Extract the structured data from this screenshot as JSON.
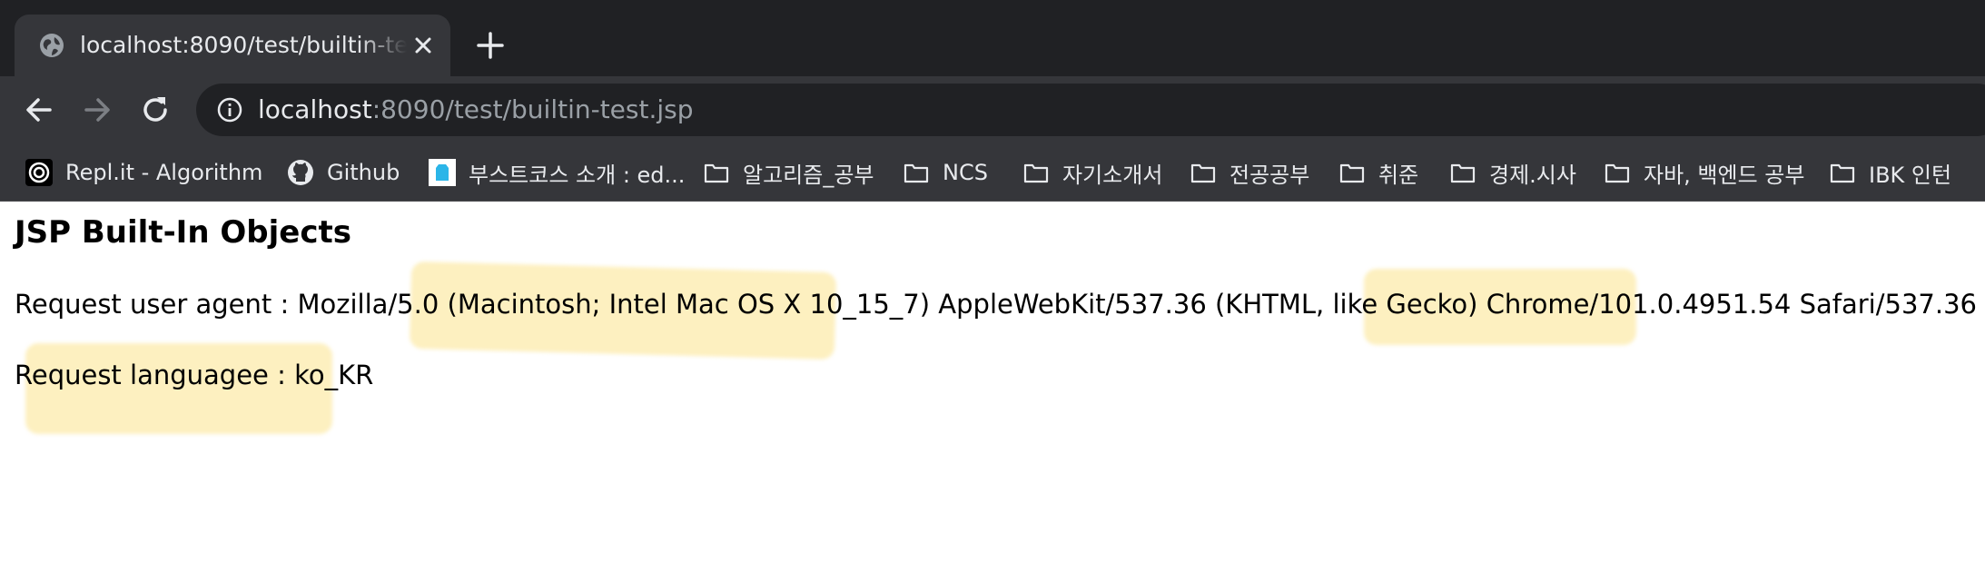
{
  "browser": {
    "tab": {
      "title": "localhost:8090/test/builtin-test.jsp",
      "favicon": "globe-icon"
    },
    "toolbar": {
      "url_host": "localhost",
      "url_rest": ":8090/test/builtin-test.jsp"
    },
    "bookmarks": [
      {
        "label": "Repl.it - Algorithm",
        "icon": "replit-icon"
      },
      {
        "label": "Github",
        "icon": "github-icon"
      },
      {
        "label": "부스트코스 소개 : ed...",
        "icon": "boostcourse-icon"
      },
      {
        "label": "알고리즘_공부",
        "icon": "folder-icon"
      },
      {
        "label": "NCS",
        "icon": "folder-icon"
      },
      {
        "label": "자기소개서",
        "icon": "folder-icon"
      },
      {
        "label": "전공공부",
        "icon": "folder-icon"
      },
      {
        "label": "취준",
        "icon": "folder-icon"
      },
      {
        "label": "경제.시사",
        "icon": "folder-icon"
      },
      {
        "label": "자바, 백엔드 공부",
        "icon": "folder-icon"
      },
      {
        "label": "IBK 인턴",
        "icon": "folder-icon"
      }
    ]
  },
  "page": {
    "title": "JSP Built-In Objects",
    "user_agent": {
      "prefix": "Request user agent : Mozilla/5.0 (",
      "platform": "Macintosh; Intel Mac OS X 10_15_7",
      "middle": ") AppleWebKit/537.36 (KHTML, like Gecko) ",
      "browser": "Chrome/101.0.4951.54",
      "suffix": " Safari/537.36"
    },
    "language": "Request languagee : ko_KR"
  },
  "colors": {
    "highlight": "#fce282",
    "tabstrip": "#202124",
    "toolbar": "#35363a"
  }
}
